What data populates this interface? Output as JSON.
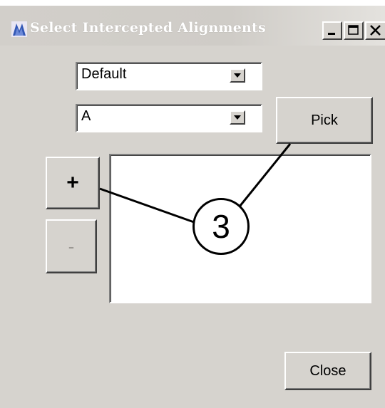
{
  "window": {
    "title": "Select Intercepted Alignments",
    "icon": "app-logo-icon",
    "title_color": "#ffffff",
    "window_controls": [
      "minimize-icon",
      "maximize-icon",
      "close-icon"
    ]
  },
  "form": {
    "combo_1": {
      "value": "Default"
    },
    "combo_2": {
      "value": "A"
    },
    "pick_label": "Pick",
    "add_label": "+",
    "remove_label": "-",
    "close_label": "Close",
    "list_items": []
  },
  "callout": {
    "number": "3"
  },
  "colors": {
    "face": "#d6d3ce",
    "highlight": "#ffffff",
    "shadow": "#404040",
    "disabled_text": "#9b9893"
  }
}
